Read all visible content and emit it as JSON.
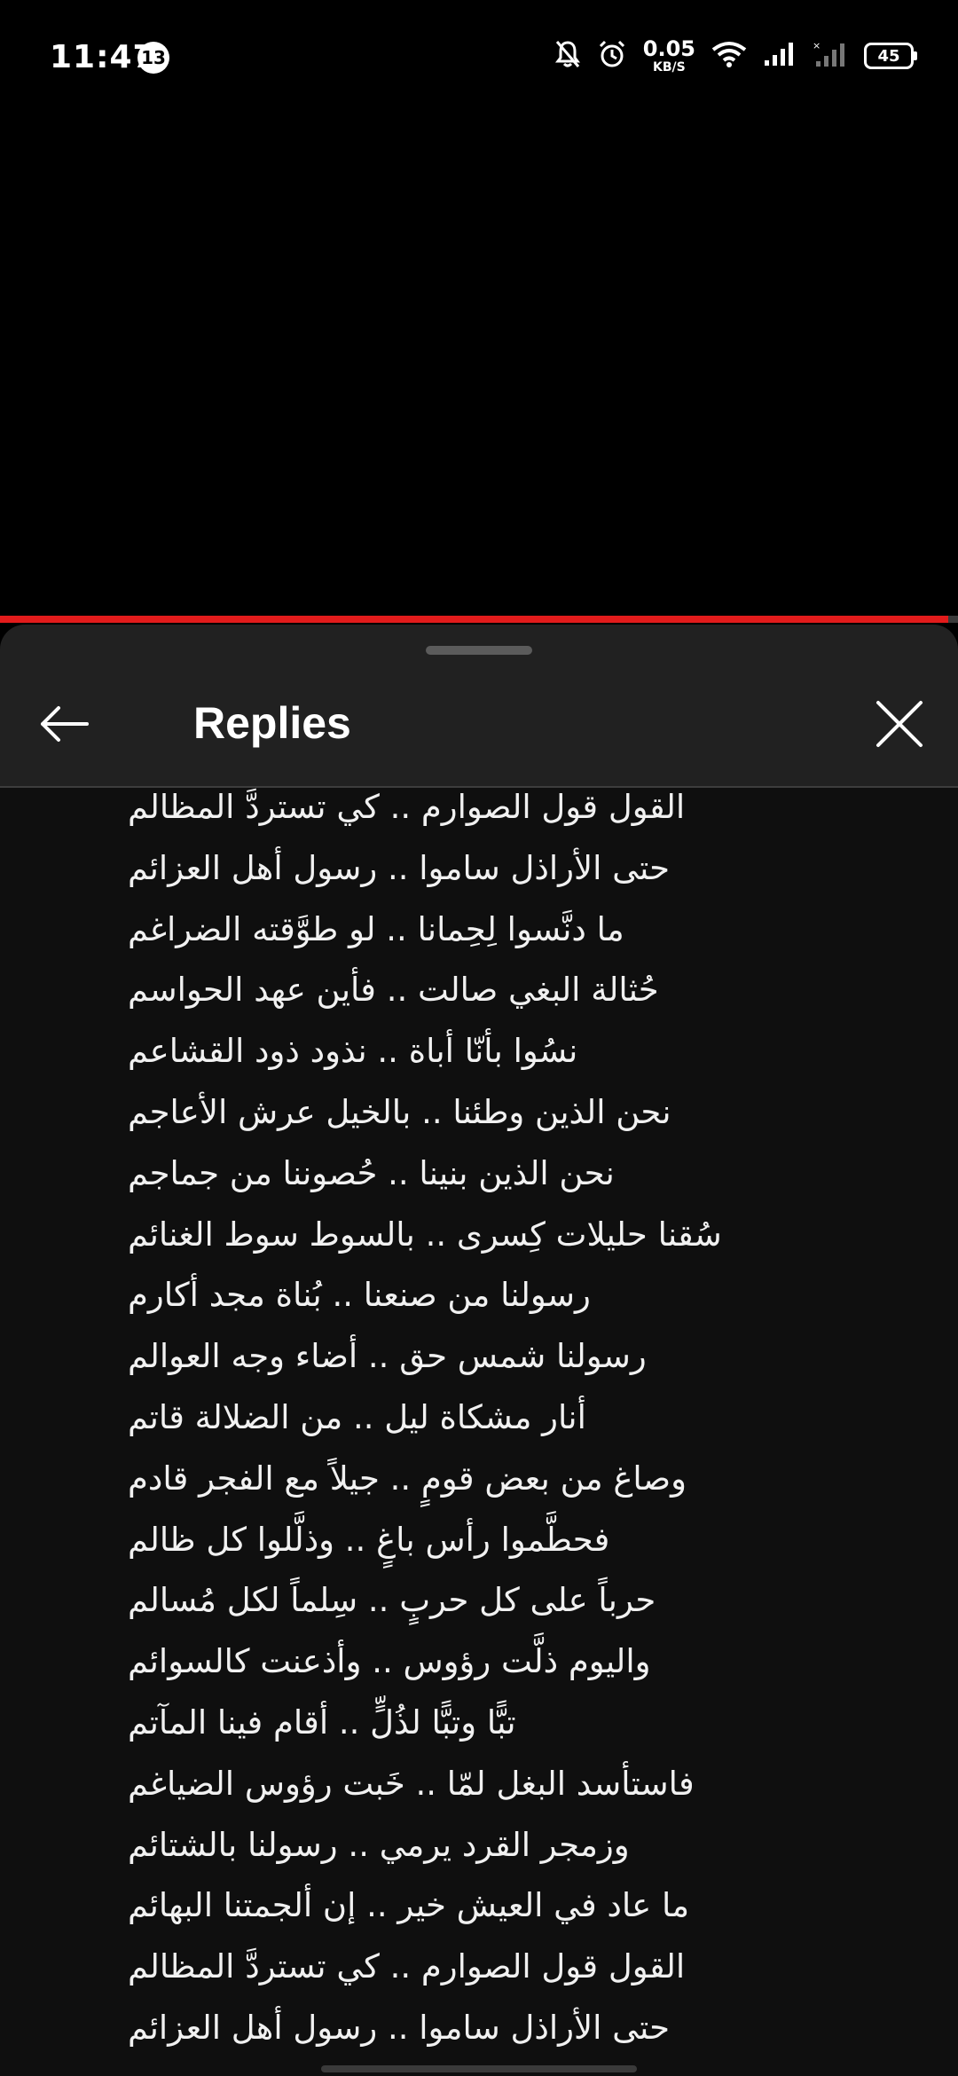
{
  "status_bar": {
    "time": "11:47",
    "notification_count": "13",
    "net_speed_value": "0.05",
    "net_speed_unit": "KB/S",
    "battery": "45"
  },
  "video": {
    "progress_fraction": 0.99,
    "progress_color": "#e21b1b"
  },
  "panel": {
    "title": "Replies",
    "back_icon": "arrow-left-icon",
    "close_icon": "close-icon"
  },
  "reply": {
    "lines": [
      "القول قول الصوارم .. كي تستردَّ المظالم",
      "حتى الأراذل ساموا .. رسول أهل العزائم",
      "ما دنَّسوا لِحِمانا .. لو طوَّقته الضراغم",
      "حُثالة البغي صالت .. فأين عهد الحواسم",
      "نسُوا بأنّا أباة .. نذود ذود القشاعم",
      "نحن الذين وطئنا .. بالخيل عرش الأعاجم",
      "نحن الذين بنينا .. حُصوننا من جماجم",
      "سُقنا حليلات كِسرى .. بالسوط سوط الغنائم",
      "رسولنا من صنعنا .. بُناة مجد أكارم",
      "رسولنا شمس حق .. أضاء وجه العوالم",
      "أنار مشكاة ليل .. من الضلالة قاتم",
      "وصاغ من بعض قومٍ .. جيلاً مع الفجر قادم",
      "فحطَّموا رأس باغٍ .. وذلَّلوا كل ظالم",
      "حرباً على كل حربٍ .. سِلماً لكل مُسالم",
      "واليوم ذلَّت رؤوس .. وأذعنت كالسوائم",
      "تبًّا وتبًّا لذُلٍّ .. أقام فينا المآتم",
      "فاستأسد البغل لمّا .. خَبت رؤوس الضياغم",
      "وزمجر القرد يرمي .. رسولنا بالشتائم",
      "ما عاد في العيش خير .. إن ألجمتنا البهائم",
      "القول قول الصوارم .. كي تستردَّ المظالم",
      "حتى الأراذل ساموا .. رسول أهل العزائم"
    ]
  }
}
